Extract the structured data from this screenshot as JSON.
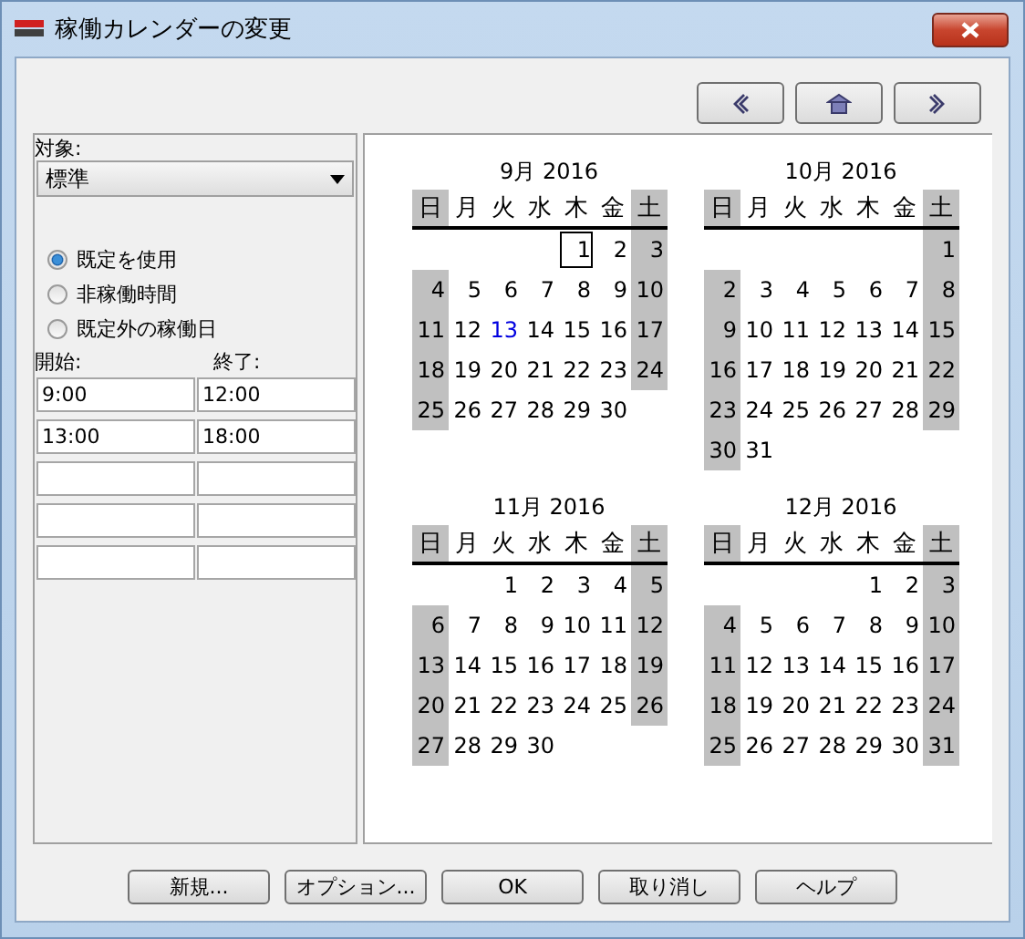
{
  "window": {
    "title": "稼働カレンダーの変更"
  },
  "nav_buttons": [
    {
      "kind": "prev"
    },
    {
      "kind": "home"
    },
    {
      "kind": "next"
    }
  ],
  "target": {
    "label": "対象:",
    "value": "標準"
  },
  "options": [
    {
      "label": "既定を使用",
      "selected": true
    },
    {
      "label": "非稼働時間",
      "selected": false
    },
    {
      "label": "既定外の稼働日",
      "selected": false
    }
  ],
  "times": {
    "start_label": "開始:",
    "end_label": "終了:",
    "rows": [
      {
        "kind": "filled",
        "start": "9:00",
        "end": "12:00"
      },
      {
        "kind": "filled",
        "start": "13:00",
        "end": "18:00"
      },
      {
        "kind": "empty"
      },
      {
        "kind": "empty"
      },
      {
        "kind": "empty"
      }
    ]
  },
  "months": [
    {
      "title": "9月 2016",
      "weekdays": [
        "日",
        "月",
        "火",
        "水",
        "木",
        "金",
        "土"
      ],
      "weeks": [
        [
          {
            "kind": "blank"
          },
          {
            "kind": "blank"
          },
          {
            "kind": "blank"
          },
          {
            "kind": "blank"
          },
          {
            "kind": "day",
            "n": "1",
            "selected": true,
            "today": false
          },
          {
            "kind": "day",
            "n": "2",
            "selected": false,
            "today": false
          },
          {
            "kind": "day",
            "n": "3",
            "selected": false,
            "today": false
          }
        ],
        [
          {
            "kind": "day",
            "n": "4",
            "selected": false,
            "today": false
          },
          {
            "kind": "day",
            "n": "5",
            "selected": false,
            "today": false
          },
          {
            "kind": "day",
            "n": "6",
            "selected": false,
            "today": false
          },
          {
            "kind": "day",
            "n": "7",
            "selected": false,
            "today": false
          },
          {
            "kind": "day",
            "n": "8",
            "selected": false,
            "today": false
          },
          {
            "kind": "day",
            "n": "9",
            "selected": false,
            "today": false
          },
          {
            "kind": "day",
            "n": "10",
            "selected": false,
            "today": false
          }
        ],
        [
          {
            "kind": "day",
            "n": "11",
            "selected": false,
            "today": false
          },
          {
            "kind": "day",
            "n": "12",
            "selected": false,
            "today": false
          },
          {
            "kind": "day",
            "n": "13",
            "selected": false,
            "today": true
          },
          {
            "kind": "day",
            "n": "14",
            "selected": false,
            "today": false
          },
          {
            "kind": "day",
            "n": "15",
            "selected": false,
            "today": false
          },
          {
            "kind": "day",
            "n": "16",
            "selected": false,
            "today": false
          },
          {
            "kind": "day",
            "n": "17",
            "selected": false,
            "today": false
          }
        ],
        [
          {
            "kind": "day",
            "n": "18",
            "selected": false,
            "today": false
          },
          {
            "kind": "day",
            "n": "19",
            "selected": false,
            "today": false
          },
          {
            "kind": "day",
            "n": "20",
            "selected": false,
            "today": false
          },
          {
            "kind": "day",
            "n": "21",
            "selected": false,
            "today": false
          },
          {
            "kind": "day",
            "n": "22",
            "selected": false,
            "today": false
          },
          {
            "kind": "day",
            "n": "23",
            "selected": false,
            "today": false
          },
          {
            "kind": "day",
            "n": "24",
            "selected": false,
            "today": false
          }
        ],
        [
          {
            "kind": "day",
            "n": "25",
            "selected": false,
            "today": false
          },
          {
            "kind": "day",
            "n": "26",
            "selected": false,
            "today": false
          },
          {
            "kind": "day",
            "n": "27",
            "selected": false,
            "today": false
          },
          {
            "kind": "day",
            "n": "28",
            "selected": false,
            "today": false
          },
          {
            "kind": "day",
            "n": "29",
            "selected": false,
            "today": false
          },
          {
            "kind": "day",
            "n": "30",
            "selected": false,
            "today": false
          },
          {
            "kind": "blank"
          }
        ]
      ]
    },
    {
      "title": "10月 2016",
      "weekdays": [
        "日",
        "月",
        "火",
        "水",
        "木",
        "金",
        "土"
      ],
      "weeks": [
        [
          {
            "kind": "blank"
          },
          {
            "kind": "blank"
          },
          {
            "kind": "blank"
          },
          {
            "kind": "blank"
          },
          {
            "kind": "blank"
          },
          {
            "kind": "blank"
          },
          {
            "kind": "day",
            "n": "1",
            "selected": false,
            "today": false
          }
        ],
        [
          {
            "kind": "day",
            "n": "2",
            "selected": false,
            "today": false
          },
          {
            "kind": "day",
            "n": "3",
            "selected": false,
            "today": false
          },
          {
            "kind": "day",
            "n": "4",
            "selected": false,
            "today": false
          },
          {
            "kind": "day",
            "n": "5",
            "selected": false,
            "today": false
          },
          {
            "kind": "day",
            "n": "6",
            "selected": false,
            "today": false
          },
          {
            "kind": "day",
            "n": "7",
            "selected": false,
            "today": false
          },
          {
            "kind": "day",
            "n": "8",
            "selected": false,
            "today": false
          }
        ],
        [
          {
            "kind": "day",
            "n": "9",
            "selected": false,
            "today": false
          },
          {
            "kind": "day",
            "n": "10",
            "selected": false,
            "today": false
          },
          {
            "kind": "day",
            "n": "11",
            "selected": false,
            "today": false
          },
          {
            "kind": "day",
            "n": "12",
            "selected": false,
            "today": false
          },
          {
            "kind": "day",
            "n": "13",
            "selected": false,
            "today": false
          },
          {
            "kind": "day",
            "n": "14",
            "selected": false,
            "today": false
          },
          {
            "kind": "day",
            "n": "15",
            "selected": false,
            "today": false
          }
        ],
        [
          {
            "kind": "day",
            "n": "16",
            "selected": false,
            "today": false
          },
          {
            "kind": "day",
            "n": "17",
            "selected": false,
            "today": false
          },
          {
            "kind": "day",
            "n": "18",
            "selected": false,
            "today": false
          },
          {
            "kind": "day",
            "n": "19",
            "selected": false,
            "today": false
          },
          {
            "kind": "day",
            "n": "20",
            "selected": false,
            "today": false
          },
          {
            "kind": "day",
            "n": "21",
            "selected": false,
            "today": false
          },
          {
            "kind": "day",
            "n": "22",
            "selected": false,
            "today": false
          }
        ],
        [
          {
            "kind": "day",
            "n": "23",
            "selected": false,
            "today": false
          },
          {
            "kind": "day",
            "n": "24",
            "selected": false,
            "today": false
          },
          {
            "kind": "day",
            "n": "25",
            "selected": false,
            "today": false
          },
          {
            "kind": "day",
            "n": "26",
            "selected": false,
            "today": false
          },
          {
            "kind": "day",
            "n": "27",
            "selected": false,
            "today": false
          },
          {
            "kind": "day",
            "n": "28",
            "selected": false,
            "today": false
          },
          {
            "kind": "day",
            "n": "29",
            "selected": false,
            "today": false
          }
        ],
        [
          {
            "kind": "day",
            "n": "30",
            "selected": false,
            "today": false
          },
          {
            "kind": "day",
            "n": "31",
            "selected": false,
            "today": false
          },
          {
            "kind": "blank"
          },
          {
            "kind": "blank"
          },
          {
            "kind": "blank"
          },
          {
            "kind": "blank"
          },
          {
            "kind": "blank"
          }
        ]
      ]
    },
    {
      "title": "11月 2016",
      "weekdays": [
        "日",
        "月",
        "火",
        "水",
        "木",
        "金",
        "土"
      ],
      "weeks": [
        [
          {
            "kind": "blank"
          },
          {
            "kind": "blank"
          },
          {
            "kind": "day",
            "n": "1",
            "selected": false,
            "today": false
          },
          {
            "kind": "day",
            "n": "2",
            "selected": false,
            "today": false
          },
          {
            "kind": "day",
            "n": "3",
            "selected": false,
            "today": false
          },
          {
            "kind": "day",
            "n": "4",
            "selected": false,
            "today": false
          },
          {
            "kind": "day",
            "n": "5",
            "selected": false,
            "today": false
          }
        ],
        [
          {
            "kind": "day",
            "n": "6",
            "selected": false,
            "today": false
          },
          {
            "kind": "day",
            "n": "7",
            "selected": false,
            "today": false
          },
          {
            "kind": "day",
            "n": "8",
            "selected": false,
            "today": false
          },
          {
            "kind": "day",
            "n": "9",
            "selected": false,
            "today": false
          },
          {
            "kind": "day",
            "n": "10",
            "selected": false,
            "today": false
          },
          {
            "kind": "day",
            "n": "11",
            "selected": false,
            "today": false
          },
          {
            "kind": "day",
            "n": "12",
            "selected": false,
            "today": false
          }
        ],
        [
          {
            "kind": "day",
            "n": "13",
            "selected": false,
            "today": false
          },
          {
            "kind": "day",
            "n": "14",
            "selected": false,
            "today": false
          },
          {
            "kind": "day",
            "n": "15",
            "selected": false,
            "today": false
          },
          {
            "kind": "day",
            "n": "16",
            "selected": false,
            "today": false
          },
          {
            "kind": "day",
            "n": "17",
            "selected": false,
            "today": false
          },
          {
            "kind": "day",
            "n": "18",
            "selected": false,
            "today": false
          },
          {
            "kind": "day",
            "n": "19",
            "selected": false,
            "today": false
          }
        ],
        [
          {
            "kind": "day",
            "n": "20",
            "selected": false,
            "today": false
          },
          {
            "kind": "day",
            "n": "21",
            "selected": false,
            "today": false
          },
          {
            "kind": "day",
            "n": "22",
            "selected": false,
            "today": false
          },
          {
            "kind": "day",
            "n": "23",
            "selected": false,
            "today": false
          },
          {
            "kind": "day",
            "n": "24",
            "selected": false,
            "today": false
          },
          {
            "kind": "day",
            "n": "25",
            "selected": false,
            "today": false
          },
          {
            "kind": "day",
            "n": "26",
            "selected": false,
            "today": false
          }
        ],
        [
          {
            "kind": "day",
            "n": "27",
            "selected": false,
            "today": false
          },
          {
            "kind": "day",
            "n": "28",
            "selected": false,
            "today": false
          },
          {
            "kind": "day",
            "n": "29",
            "selected": false,
            "today": false
          },
          {
            "kind": "day",
            "n": "30",
            "selected": false,
            "today": false
          },
          {
            "kind": "blank"
          },
          {
            "kind": "blank"
          },
          {
            "kind": "blank"
          }
        ]
      ]
    },
    {
      "title": "12月 2016",
      "weekdays": [
        "日",
        "月",
        "火",
        "水",
        "木",
        "金",
        "土"
      ],
      "weeks": [
        [
          {
            "kind": "blank"
          },
          {
            "kind": "blank"
          },
          {
            "kind": "blank"
          },
          {
            "kind": "blank"
          },
          {
            "kind": "day",
            "n": "1",
            "selected": false,
            "today": false
          },
          {
            "kind": "day",
            "n": "2",
            "selected": false,
            "today": false
          },
          {
            "kind": "day",
            "n": "3",
            "selected": false,
            "today": false
          }
        ],
        [
          {
            "kind": "day",
            "n": "4",
            "selected": false,
            "today": false
          },
          {
            "kind": "day",
            "n": "5",
            "selected": false,
            "today": false
          },
          {
            "kind": "day",
            "n": "6",
            "selected": false,
            "today": false
          },
          {
            "kind": "day",
            "n": "7",
            "selected": false,
            "today": false
          },
          {
            "kind": "day",
            "n": "8",
            "selected": false,
            "today": false
          },
          {
            "kind": "day",
            "n": "9",
            "selected": false,
            "today": false
          },
          {
            "kind": "day",
            "n": "10",
            "selected": false,
            "today": false
          }
        ],
        [
          {
            "kind": "day",
            "n": "11",
            "selected": false,
            "today": false
          },
          {
            "kind": "day",
            "n": "12",
            "selected": false,
            "today": false
          },
          {
            "kind": "day",
            "n": "13",
            "selected": false,
            "today": false
          },
          {
            "kind": "day",
            "n": "14",
            "selected": false,
            "today": false
          },
          {
            "kind": "day",
            "n": "15",
            "selected": false,
            "today": false
          },
          {
            "kind": "day",
            "n": "16",
            "selected": false,
            "today": false
          },
          {
            "kind": "day",
            "n": "17",
            "selected": false,
            "today": false
          }
        ],
        [
          {
            "kind": "day",
            "n": "18",
            "selected": false,
            "today": false
          },
          {
            "kind": "day",
            "n": "19",
            "selected": false,
            "today": false
          },
          {
            "kind": "day",
            "n": "20",
            "selected": false,
            "today": false
          },
          {
            "kind": "day",
            "n": "21",
            "selected": false,
            "today": false
          },
          {
            "kind": "day",
            "n": "22",
            "selected": false,
            "today": false
          },
          {
            "kind": "day",
            "n": "23",
            "selected": false,
            "today": false
          },
          {
            "kind": "day",
            "n": "24",
            "selected": false,
            "today": false
          }
        ],
        [
          {
            "kind": "day",
            "n": "25",
            "selected": false,
            "today": false
          },
          {
            "kind": "day",
            "n": "26",
            "selected": false,
            "today": false
          },
          {
            "kind": "day",
            "n": "27",
            "selected": false,
            "today": false
          },
          {
            "kind": "day",
            "n": "28",
            "selected": false,
            "today": false
          },
          {
            "kind": "day",
            "n": "29",
            "selected": false,
            "today": false
          },
          {
            "kind": "day",
            "n": "30",
            "selected": false,
            "today": false
          },
          {
            "kind": "day",
            "n": "31",
            "selected": false,
            "today": false
          }
        ]
      ]
    }
  ],
  "buttons": [
    "新規...",
    "オプション...",
    "OK",
    "取り消し",
    "ヘルプ"
  ]
}
